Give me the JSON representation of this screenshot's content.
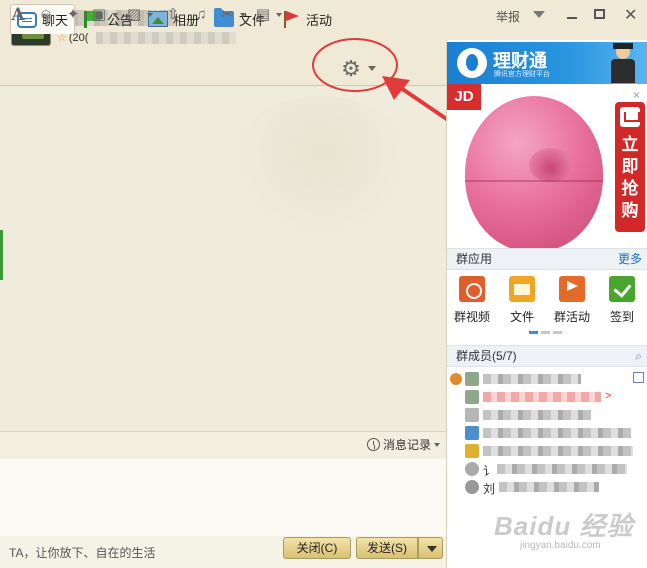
{
  "window": {
    "report_label": "举报",
    "subtitle_prefix": "(20("
  },
  "toolbar": {
    "tabs": [
      {
        "label": "聊天",
        "icon": "chat-icon"
      },
      {
        "label": "公告",
        "icon": "notice-icon"
      },
      {
        "label": "相册",
        "icon": "album-icon"
      },
      {
        "label": "文件",
        "icon": "file-icon"
      },
      {
        "label": "活动",
        "icon": "flag-icon"
      }
    ],
    "settings_icon": "gear-icon"
  },
  "input_toolbar": {
    "icons": [
      "font-icon",
      "emoji-icon",
      "magic-wand-icon",
      "screenshot-icon",
      "image-icon",
      "upload-icon",
      "music-icon",
      "scissors-icon",
      "more-icon"
    ],
    "message_log_label": "消息记录"
  },
  "bottom": {
    "status_text": "TA，让你放下、自在的生活",
    "close_label": "关闭(C)",
    "send_label": "发送(S)"
  },
  "ads": {
    "banner_title": "理财通",
    "banner_subtitle": "腾讯官方理财平台",
    "brand": "JD",
    "cta": "立即抢购",
    "close_glyph": "×"
  },
  "group_apps": {
    "title": "群应用",
    "more_label": "更多",
    "items": [
      {
        "label": "群视频",
        "icon": "video-icon"
      },
      {
        "label": "文件",
        "icon": "folder-icon"
      },
      {
        "label": "群活动",
        "icon": "event-icon"
      },
      {
        "label": "签到",
        "icon": "checkin-icon"
      }
    ]
  },
  "members": {
    "title": "群成员(5/7)",
    "visible_names": [
      "讠",
      "刘"
    ],
    "red_tail": ">"
  },
  "watermark": {
    "text": "Baidu 经验",
    "url": "jingyan.baidu.com"
  }
}
